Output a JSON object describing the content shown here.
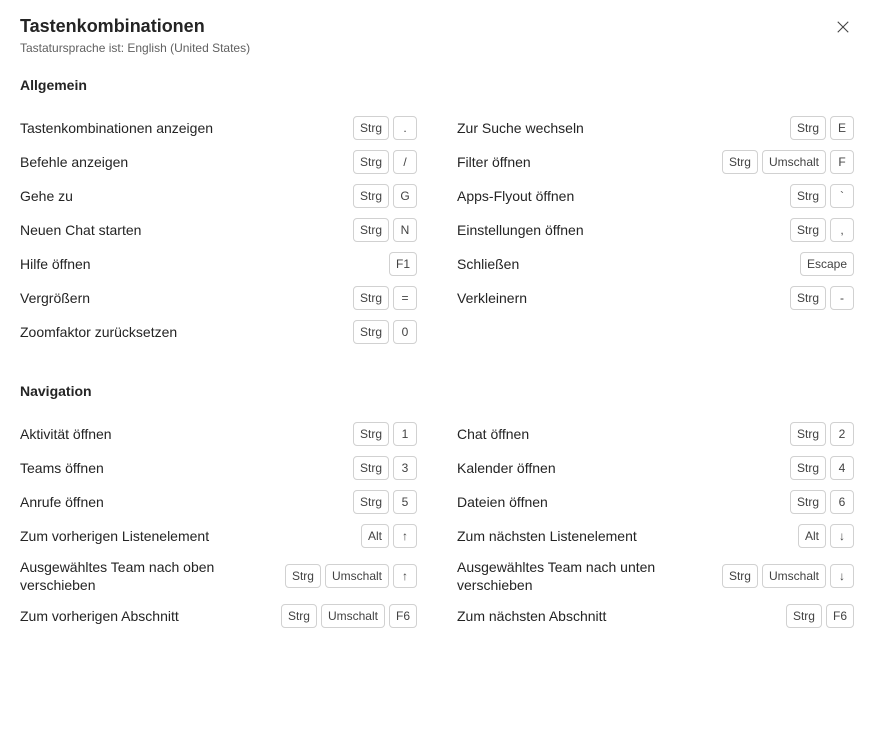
{
  "title": "Tastenkombinationen",
  "subtitle": "Tastatursprache ist: English (United States)",
  "sections": [
    {
      "heading": "Allgemein",
      "rows": [
        {
          "label": "Tastenkombinationen anzeigen",
          "keys": [
            "Strg",
            "."
          ]
        },
        {
          "label": "Zur Suche wechseln",
          "keys": [
            "Strg",
            "E"
          ]
        },
        {
          "label": "Befehle anzeigen",
          "keys": [
            "Strg",
            "/"
          ]
        },
        {
          "label": "Filter öffnen",
          "keys": [
            "Strg",
            "Umschalt",
            "F"
          ]
        },
        {
          "label": "Gehe zu",
          "keys": [
            "Strg",
            "G"
          ]
        },
        {
          "label": "Apps-Flyout öffnen",
          "keys": [
            "Strg",
            "`"
          ]
        },
        {
          "label": "Neuen Chat starten",
          "keys": [
            "Strg",
            "N"
          ]
        },
        {
          "label": "Einstellungen öffnen",
          "keys": [
            "Strg",
            ","
          ]
        },
        {
          "label": "Hilfe öffnen",
          "keys": [
            "F1"
          ]
        },
        {
          "label": "Schließen",
          "keys": [
            "Escape"
          ]
        },
        {
          "label": "Vergrößern",
          "keys": [
            "Strg",
            "="
          ]
        },
        {
          "label": "Verkleinern",
          "keys": [
            "Strg",
            "-"
          ]
        },
        {
          "label": "Zoomfaktor zurücksetzen",
          "keys": [
            "Strg",
            "0"
          ]
        }
      ]
    },
    {
      "heading": "Navigation",
      "rows": [
        {
          "label": "Aktivität öffnen",
          "keys": [
            "Strg",
            "1"
          ]
        },
        {
          "label": "Chat öffnen",
          "keys": [
            "Strg",
            "2"
          ]
        },
        {
          "label": "Teams öffnen",
          "keys": [
            "Strg",
            "3"
          ]
        },
        {
          "label": "Kalender öffnen",
          "keys": [
            "Strg",
            "4"
          ]
        },
        {
          "label": "Anrufe öffnen",
          "keys": [
            "Strg",
            "5"
          ]
        },
        {
          "label": "Dateien öffnen",
          "keys": [
            "Strg",
            "6"
          ]
        },
        {
          "label": "Zum vorherigen Listenelement",
          "keys": [
            "Alt",
            "↑"
          ]
        },
        {
          "label": "Zum nächsten Listenelement",
          "keys": [
            "Alt",
            "↓"
          ]
        },
        {
          "label": "Ausgewähltes Team nach oben verschieben",
          "keys": [
            "Strg",
            "Umschalt",
            "↑"
          ]
        },
        {
          "label": "Ausgewähltes Team nach unten verschieben",
          "keys": [
            "Strg",
            "Umschalt",
            "↓"
          ]
        },
        {
          "label": "Zum vorherigen Abschnitt",
          "keys": [
            "Strg",
            "Umschalt",
            "F6"
          ]
        },
        {
          "label": "Zum nächsten Abschnitt",
          "keys": [
            "Strg",
            "F6"
          ]
        }
      ]
    }
  ]
}
